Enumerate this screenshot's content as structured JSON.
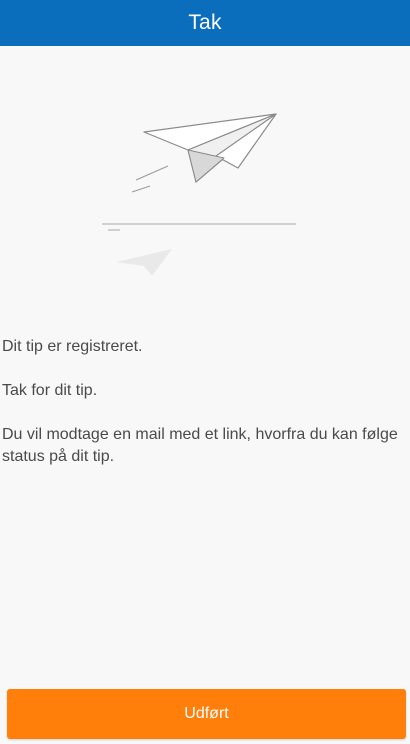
{
  "header": {
    "title": "Tak"
  },
  "illustration": {
    "icon": "paper-plane-icon"
  },
  "message": {
    "line1": "Dit tip er registreret.",
    "line2": "Tak for dit tip.",
    "line3": "Du vil modtage en mail med et link, hvorfra du kan følge status på dit tip."
  },
  "actions": {
    "done_label": "Udført"
  },
  "colors": {
    "header_bg": "#0a6ebd",
    "button_bg": "#ff7f0a",
    "page_bg": "#f8f8f8",
    "text": "#4a4a4a"
  }
}
